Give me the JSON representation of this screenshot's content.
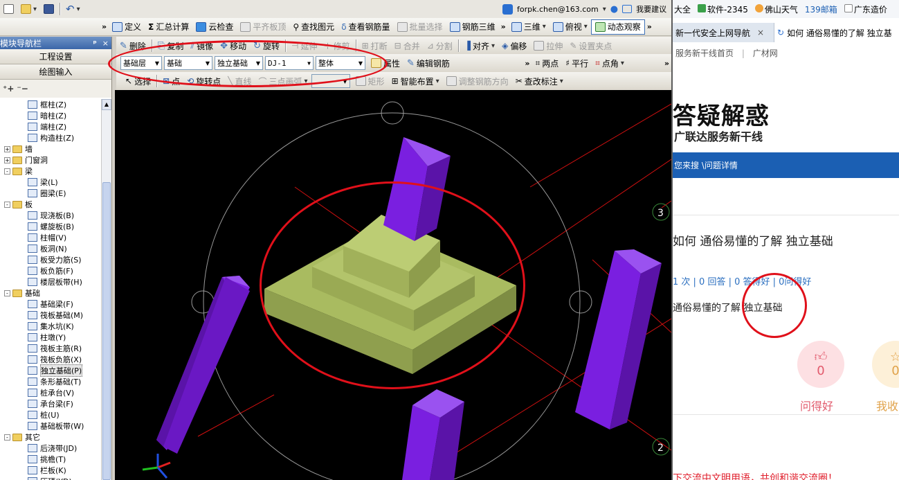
{
  "topbar": {
    "email": "forpk.chen@163.com",
    "feedback": "我要建议"
  },
  "toolbar1": {
    "items": [
      "定义",
      "汇总计算",
      "云检查",
      "平齐板顶",
      "查找图元",
      "查看钢筋量",
      "批量选择",
      "钢筋三维"
    ],
    "view_3d": "三维",
    "view_top": "俯视",
    "dynamic": "动态观察"
  },
  "toolbar2": [
    "删除",
    "复制",
    "镜像",
    "移动",
    "旋转",
    "延伸",
    "修剪",
    "打断",
    "合并",
    "分割",
    "对齐",
    "偏移",
    "拉伸",
    "设置夹点"
  ],
  "toolbar3": {
    "layer": "基础层",
    "category": "基础",
    "type": "独立基础",
    "component": "DJ-1",
    "scope": "整体",
    "properties": "属性",
    "edit_rebar": "编辑钢筋",
    "two_points": "两点",
    "parallel": "平行",
    "point_angle": "点角"
  },
  "toolbar4": {
    "select": "选择",
    "point": "点",
    "rotate_point": "旋转点",
    "line": "直线",
    "three_point_arc": "三点画弧",
    "rectangle": "矩形",
    "smart_layout": "智能布置",
    "adjust_dir": "调整钢筋方向",
    "check_label": "查改标注"
  },
  "nav": {
    "title": "模块导航栏",
    "pin": "ꟼ",
    "close": "×",
    "project_settings": "工程设置",
    "drawing_input": "绘图输入",
    "tree": [
      {
        "label": "框柱(Z)",
        "level": 2,
        "kind": "leaf"
      },
      {
        "label": "暗柱(Z)",
        "level": 2,
        "kind": "leaf"
      },
      {
        "label": "端柱(Z)",
        "level": 2,
        "kind": "leaf"
      },
      {
        "label": "构造柱(Z)",
        "level": 2,
        "kind": "leaf"
      },
      {
        "label": "墙",
        "level": 1,
        "kind": "folder",
        "exp": "+"
      },
      {
        "label": "门窗洞",
        "level": 1,
        "kind": "folder",
        "exp": "+"
      },
      {
        "label": "梁",
        "level": 1,
        "kind": "folder",
        "exp": "-"
      },
      {
        "label": "梁(L)",
        "level": 2,
        "kind": "leaf"
      },
      {
        "label": "圈梁(E)",
        "level": 2,
        "kind": "leaf"
      },
      {
        "label": "板",
        "level": 1,
        "kind": "folder",
        "exp": "-"
      },
      {
        "label": "现浇板(B)",
        "level": 2,
        "kind": "leaf"
      },
      {
        "label": "螺旋板(B)",
        "level": 2,
        "kind": "leaf"
      },
      {
        "label": "柱帽(V)",
        "level": 2,
        "kind": "leaf"
      },
      {
        "label": "板洞(N)",
        "level": 2,
        "kind": "leaf"
      },
      {
        "label": "板受力筋(S)",
        "level": 2,
        "kind": "leaf"
      },
      {
        "label": "板负筋(F)",
        "level": 2,
        "kind": "leaf"
      },
      {
        "label": "楼层板带(H)",
        "level": 2,
        "kind": "leaf"
      },
      {
        "label": "基础",
        "level": 1,
        "kind": "folder",
        "exp": "-"
      },
      {
        "label": "基础梁(F)",
        "level": 2,
        "kind": "leaf"
      },
      {
        "label": "筏板基础(M)",
        "level": 2,
        "kind": "leaf"
      },
      {
        "label": "集水坑(K)",
        "level": 2,
        "kind": "leaf"
      },
      {
        "label": "柱墩(Y)",
        "level": 2,
        "kind": "leaf"
      },
      {
        "label": "筏板主筋(R)",
        "level": 2,
        "kind": "leaf"
      },
      {
        "label": "筏板负筋(X)",
        "level": 2,
        "kind": "leaf"
      },
      {
        "label": "独立基础(P)",
        "level": 2,
        "kind": "leaf",
        "selected": true
      },
      {
        "label": "条形基础(T)",
        "level": 2,
        "kind": "leaf"
      },
      {
        "label": "桩承台(V)",
        "level": 2,
        "kind": "leaf"
      },
      {
        "label": "承台梁(F)",
        "level": 2,
        "kind": "leaf"
      },
      {
        "label": "桩(U)",
        "level": 2,
        "kind": "leaf"
      },
      {
        "label": "基础板带(W)",
        "level": 2,
        "kind": "leaf"
      },
      {
        "label": "其它",
        "level": 1,
        "kind": "folder",
        "exp": "-"
      },
      {
        "label": "后浇带(JD)",
        "level": 2,
        "kind": "leaf"
      },
      {
        "label": "挑檐(T)",
        "level": 2,
        "kind": "leaf"
      },
      {
        "label": "栏板(K)",
        "level": 2,
        "kind": "leaf"
      },
      {
        "label": "压顶(YD)",
        "level": 2,
        "kind": "leaf"
      }
    ]
  },
  "viewport": {
    "axis_label_3": "3",
    "axis_label_2": "2",
    "colors": {
      "footing": "#9bae57",
      "column": "#7a1fe0",
      "grid": "#d01010"
    }
  },
  "browser": {
    "bookmarks": [
      "大全",
      "软件-2345",
      "佛山天气",
      "139邮箱",
      "广东造价"
    ],
    "bookmark_prefix_139": "139",
    "tabs": [
      {
        "label": "新一代安全上网导航",
        "close": "×"
      },
      {
        "label": "如何 通俗易懂的了解 独立基"
      }
    ],
    "site_nav": [
      "服务新干线首页",
      "|",
      "广材网"
    ],
    "logo": "答疑解惑",
    "logo_sub": "广联达服务新干线",
    "breadcrumb": "您来搜 \\问题详情",
    "question_title": "如何 通俗易懂的了解 独立基础",
    "stats": "1 次 | 0 回答 | 0 答得好 | 0问得好",
    "question_body": "通俗易懂的了解 独立基础",
    "like_count": "0",
    "like_label": "问得好",
    "fav_count": "0",
    "fav_label": "我收",
    "footer": "下交流中文明用语，共创和谐交流圈！"
  }
}
